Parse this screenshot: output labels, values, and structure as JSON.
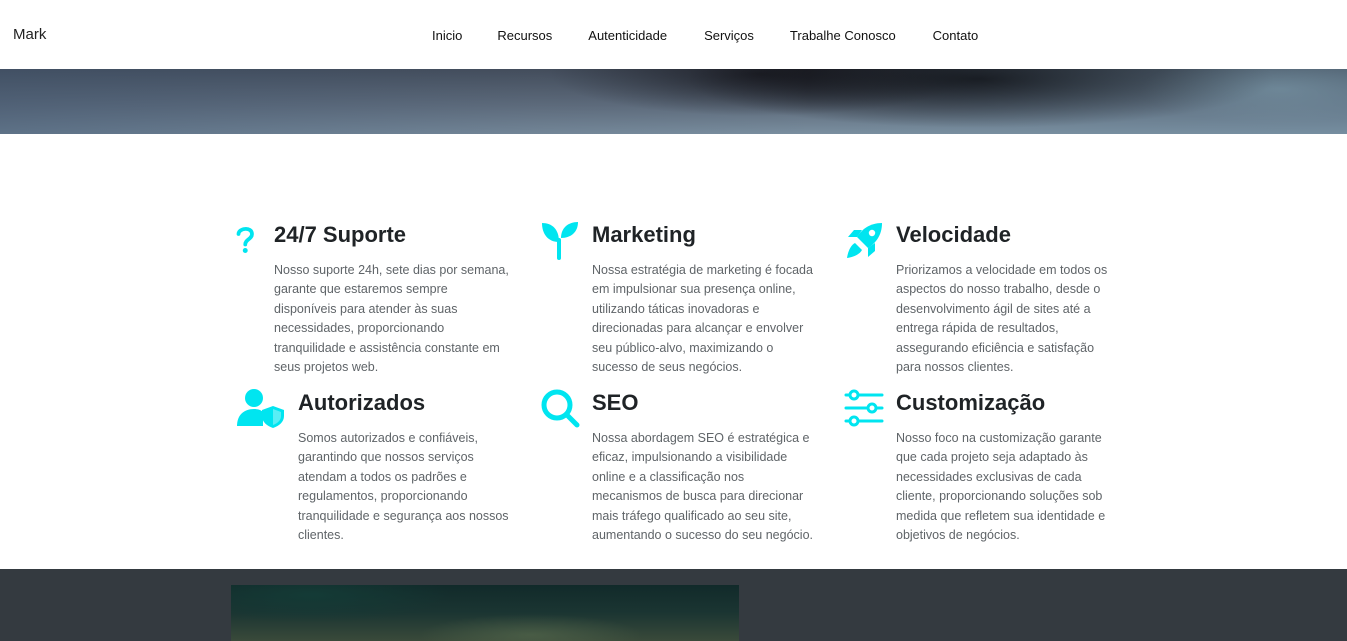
{
  "brand": "Mark",
  "nav": [
    {
      "label": "Inicio"
    },
    {
      "label": "Recursos"
    },
    {
      "label": "Autenticidade"
    },
    {
      "label": "Serviços"
    },
    {
      "label": "Trabalhe Conosco"
    },
    {
      "label": "Contato"
    }
  ],
  "colors": {
    "accent": "#00e5f0",
    "heading": "#1f2326",
    "body_text": "#5f6468",
    "footer_band": "#343a40"
  },
  "features": [
    {
      "icon": "question-icon",
      "title": "24/7 Suporte",
      "text": "Nosso suporte 24h, sete dias por semana, garante que estaremos sempre disponíveis para atender às suas necessidades, proporcionando tranquilidade e assistência constante em seus projetos web."
    },
    {
      "icon": "sprout-icon",
      "title": "Marketing",
      "text": "Nossa estratégia de marketing é focada em impulsionar sua presença online, utilizando táticas inovadoras e direcionadas para alcançar e envolver seu público-alvo, maximizando o sucesso de seus negócios."
    },
    {
      "icon": "rocket-icon",
      "title": "Velocidade",
      "text": "Priorizamos a velocidade em todos os aspectos do nosso trabalho, desde o desenvolvimento ágil de sites até a entrega rápida de resultados, assegurando eficiência e satisfação para nossos clientes."
    },
    {
      "icon": "user-shield-icon",
      "title": "Autorizados",
      "text": "Somos autorizados e confiáveis, garantindo que nossos serviços atendam a todos os padrões e regulamentos, proporcionando tranquilidade e segurança aos nossos clientes."
    },
    {
      "icon": "search-icon",
      "title": "SEO",
      "text": "Nossa abordagem SEO é estratégica e eficaz, impulsionando a visibilidade online e a classificação nos mecanismos de busca para direcionar mais tráfego qualificado ao seu site, aumentando o sucesso do seu negócio."
    },
    {
      "icon": "sliders-icon",
      "title": "Customização",
      "text": "Nosso foco na customização garante que cada projeto seja adaptado às necessidades exclusivas de cada cliente, proporcionando soluções sob medida que refletem sua identidade e objetivos de negócios."
    }
  ]
}
